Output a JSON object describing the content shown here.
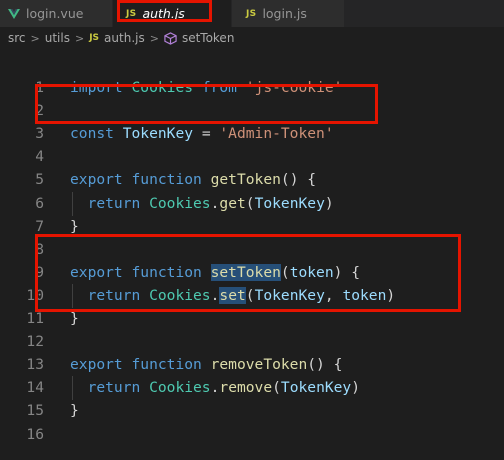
{
  "tabs": [
    {
      "label": "login.vue",
      "type": "vue",
      "active": false
    },
    {
      "label": "auth.js",
      "type": "js",
      "active": true
    },
    {
      "label": "login.js",
      "type": "js",
      "active": false
    }
  ],
  "js_badge": "JS",
  "breadcrumb": {
    "folder1": "src",
    "folder2": "utils",
    "file": "auth.js",
    "symbol": "setToken",
    "separator": ">"
  },
  "code_lines": [
    {
      "n": "1",
      "tokens": [
        [
          "import",
          "kw"
        ],
        [
          " ",
          "pun"
        ],
        [
          "Cookies",
          "cls"
        ],
        [
          " ",
          "pun"
        ],
        [
          "from",
          "kw"
        ],
        [
          " ",
          "pun"
        ],
        [
          "'js-cookie'",
          "str"
        ]
      ]
    },
    {
      "n": "2",
      "tokens": []
    },
    {
      "n": "3",
      "tokens": [
        [
          "const",
          "kw2"
        ],
        [
          " ",
          "pun"
        ],
        [
          "TokenKey",
          "var"
        ],
        [
          " = ",
          "pun"
        ],
        [
          "'Admin-Token'",
          "str"
        ]
      ]
    },
    {
      "n": "4",
      "tokens": []
    },
    {
      "n": "5",
      "tokens": [
        [
          "export",
          "kw"
        ],
        [
          " ",
          "pun"
        ],
        [
          "function",
          "kw2"
        ],
        [
          " ",
          "pun"
        ],
        [
          "getToken",
          "fn"
        ],
        [
          "() {",
          "pun"
        ]
      ]
    },
    {
      "n": "6",
      "guide": true,
      "tokens": [
        [
          "  ",
          "pun"
        ],
        [
          "return",
          "kw"
        ],
        [
          " ",
          "pun"
        ],
        [
          "Cookies",
          "cls"
        ],
        [
          ".",
          "pun"
        ],
        [
          "get",
          "fn"
        ],
        [
          "(",
          "pun"
        ],
        [
          "TokenKey",
          "var"
        ],
        [
          ")",
          "pun"
        ]
      ]
    },
    {
      "n": "7",
      "tokens": [
        [
          "}",
          "pun"
        ]
      ]
    },
    {
      "n": "8",
      "tokens": []
    },
    {
      "n": "9",
      "tokens": [
        [
          "export",
          "kw"
        ],
        [
          " ",
          "pun"
        ],
        [
          "function",
          "kw2"
        ],
        [
          " ",
          "pun"
        ],
        [
          "setToken",
          "fn hl"
        ],
        [
          "(",
          "pun"
        ],
        [
          "token",
          "var"
        ],
        [
          ") {",
          "pun"
        ]
      ]
    },
    {
      "n": "10",
      "guide": true,
      "tokens": [
        [
          "  ",
          "pun"
        ],
        [
          "return",
          "kw"
        ],
        [
          " ",
          "pun"
        ],
        [
          "Cookies",
          "cls"
        ],
        [
          ".",
          "pun"
        ],
        [
          "set",
          "fn hl"
        ],
        [
          "(",
          "pun"
        ],
        [
          "TokenKey",
          "var"
        ],
        [
          ", ",
          "pun"
        ],
        [
          "token",
          "var"
        ],
        [
          ")",
          "pun"
        ]
      ]
    },
    {
      "n": "11",
      "tokens": [
        [
          "}",
          "pun"
        ]
      ]
    },
    {
      "n": "12",
      "tokens": []
    },
    {
      "n": "13",
      "tokens": [
        [
          "export",
          "kw"
        ],
        [
          " ",
          "pun"
        ],
        [
          "function",
          "kw2"
        ],
        [
          " ",
          "pun"
        ],
        [
          "removeToken",
          "fn"
        ],
        [
          "() {",
          "pun"
        ]
      ]
    },
    {
      "n": "14",
      "guide": true,
      "tokens": [
        [
          "  ",
          "pun"
        ],
        [
          "return",
          "kw"
        ],
        [
          " ",
          "pun"
        ],
        [
          "Cookies",
          "cls"
        ],
        [
          ".",
          "pun"
        ],
        [
          "remove",
          "fn"
        ],
        [
          "(",
          "pun"
        ],
        [
          "TokenKey",
          "var"
        ],
        [
          ")",
          "pun"
        ]
      ]
    },
    {
      "n": "15",
      "tokens": [
        [
          "}",
          "pun"
        ]
      ]
    },
    {
      "n": "16",
      "tokens": []
    }
  ],
  "colors": {
    "background": "#1e1e1e",
    "annotation_red": "#e51400",
    "keyword": "#569cd6",
    "class": "#4ec9b0",
    "function": "#dcdcaa",
    "variable": "#9cdcfe",
    "string": "#ce9178"
  }
}
